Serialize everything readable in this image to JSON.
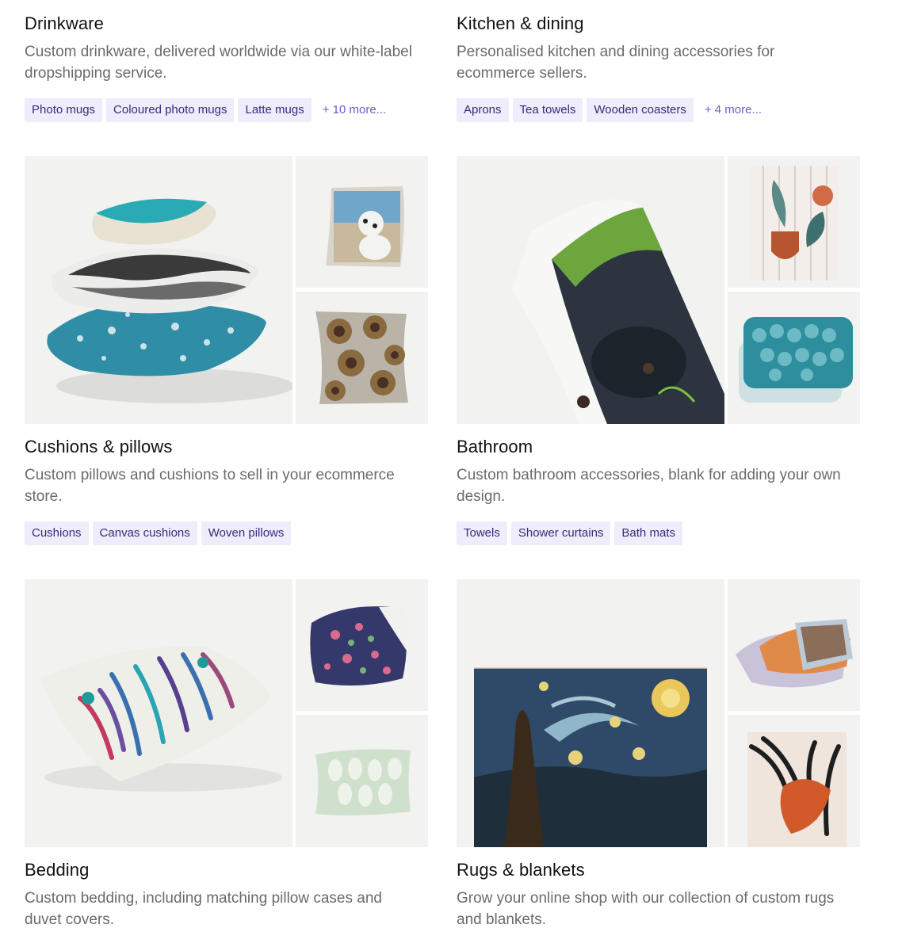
{
  "categories": {
    "drinkware": {
      "title": "Drinkware",
      "description": "Custom drinkware, delivered worldwide via our white-label dropshipping service.",
      "tags": [
        "Photo mugs",
        "Coloured photo mugs",
        "Latte mugs"
      ],
      "more": "+ 10 more..."
    },
    "kitchen": {
      "title": "Kitchen & dining",
      "description": "Personalised kitchen and dining accessories for ecommerce sellers.",
      "tags": [
        "Aprons",
        "Tea towels",
        "Wooden coasters"
      ],
      "more": "+ 4 more..."
    },
    "cushions": {
      "title": "Cushions & pillows",
      "description": "Custom pillows and cushions to sell in your ecommerce store.",
      "tags": [
        "Cushions",
        "Canvas cushions",
        "Woven pillows"
      ]
    },
    "bathroom": {
      "title": "Bathroom",
      "description": "Custom bathroom accessories, blank for adding your own design.",
      "tags": [
        "Towels",
        "Shower curtains",
        "Bath mats"
      ]
    },
    "bedding": {
      "title": "Bedding",
      "description": "Custom bedding, including matching pillow cases and duvet covers."
    },
    "rugs": {
      "title": "Rugs & blankets",
      "description": "Grow your online shop with our collection of custom rugs and blankets."
    }
  },
  "colors": {
    "tag_bg": "#efecfb",
    "tag_text": "#3a2a7a",
    "more_link": "#6a5cc9",
    "image_bg": "#f2f2f1"
  }
}
